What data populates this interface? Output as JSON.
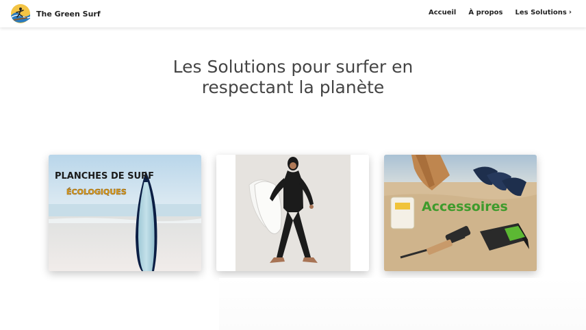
{
  "header": {
    "site_title": "The Green Surf",
    "nav": [
      {
        "label": "Accueil"
      },
      {
        "label": "À propos"
      },
      {
        "label": "Les Solutions"
      }
    ],
    "dropdown_chevron": "›"
  },
  "hero": {
    "title_line1": "Les Solutions pour surfer en",
    "title_line2": "respectant la planète"
  },
  "cards": [
    {
      "text_line1": "PLANCHES DE SURF",
      "text_line2": "ÉCOLOGIQUES"
    },
    {},
    {
      "text": "Accessoires"
    }
  ],
  "colors": {
    "accent_green": "#3e9b2c",
    "title_gray": "#444444"
  },
  "icons": {
    "logo": "surfer-logo-icon",
    "nav_chevron": "chevron-right-icon"
  }
}
